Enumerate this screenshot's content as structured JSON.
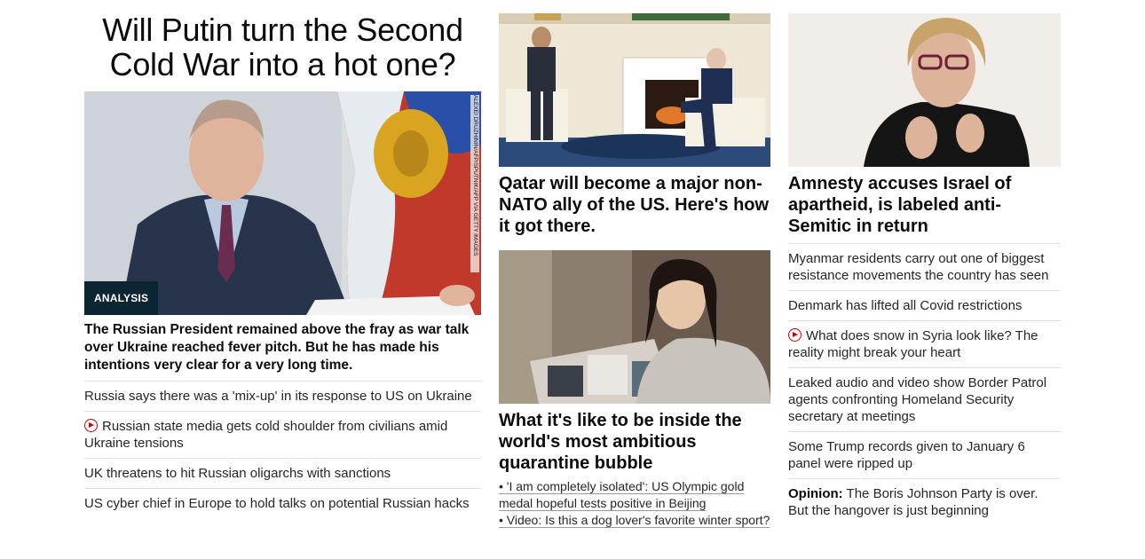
{
  "lead": {
    "headline": "Will Putin turn the Second Cold War into a hot one?",
    "badge": "ANALYSIS",
    "photo_credit": "ALEXEI DRUZHININ/AFP/SPUTNIK/AFP VIA GETTY IMAGES",
    "description": "The Russian President remained above the fray as war talk over Ukraine reached fever pitch. But he has made his intentions very clear for a very long time.",
    "links": [
      {
        "text": "Russia says there was a 'mix-up' in its response to US on Ukraine",
        "video": false
      },
      {
        "text": "Russian state media gets cold shoulder from civilians amid Ukraine tensions",
        "video": true
      },
      {
        "text": "UK threatens to hit Russian oligarchs with sanctions",
        "video": false
      },
      {
        "text": "US cyber chief in Europe to hold talks on potential Russian hacks",
        "video": false
      }
    ]
  },
  "middle": {
    "card1_title": "Qatar will become a major non-NATO ally of the US. Here's how it got there.",
    "card2_title": "What it's like to be inside the world's most ambitious quarantine bubble",
    "sub_links": [
      "• 'I am completely isolated': US Olympic gold medal hopeful tests positive in Beijing",
      "• Video: Is this a dog lover's favorite winter sport?"
    ]
  },
  "right": {
    "card_title": "Amnesty accuses Israel of apartheid, is labeled anti-Semitic in return",
    "links": [
      {
        "text": "Myanmar residents carry out one of biggest resistance movements the country has seen",
        "video": false
      },
      {
        "text": "Denmark has lifted all Covid restrictions",
        "video": false
      },
      {
        "text": "What does snow in Syria look like? The reality might break your heart",
        "video": true
      },
      {
        "text": "Leaked audio and video show Border Patrol agents confronting Homeland Security secretary at meetings",
        "video": false
      },
      {
        "text": "Some Trump records given to January 6 panel were ripped up",
        "video": false
      }
    ],
    "opinion_label": "Opinion:",
    "opinion_text": " The Boris Johnson Party is over. But the hangover is just beginning"
  },
  "colors": {
    "badge": "#0c2533",
    "video_icon": "#cc0000",
    "divider": "#e1e1e1"
  }
}
